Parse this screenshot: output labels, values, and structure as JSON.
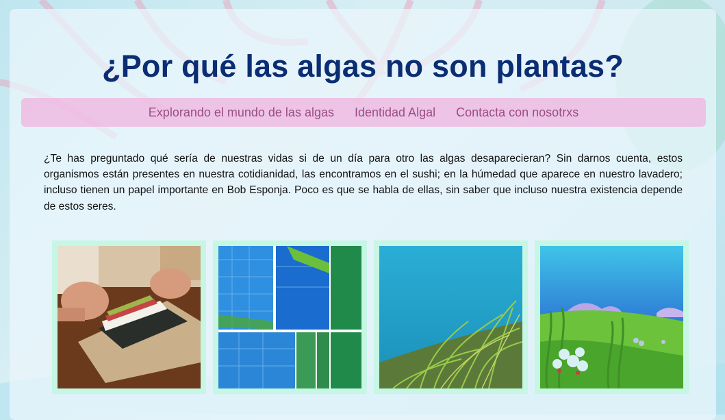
{
  "page": {
    "title": "¿Por qué las algas no son plantas?",
    "nav": [
      {
        "label": "Explorando el mundo de las algas"
      },
      {
        "label": "Identidad Algal"
      },
      {
        "label": "Contacta con nosotrxs"
      }
    ],
    "intro": "¿Te has preguntado qué sería de nuestras vidas si de un día para otro las algas desaparecieran? Sin darnos cuenta, estos organismos están presentes en nuestra cotidianidad, las encontramos en el sushi; en la húmedad que aparece en nuestro lavadero; incluso tienen un papel importante en Bob Esponja. Poco es que se habla de ellas, sin saber que incluso nuestra existencia depende de estos seres."
  },
  "gallery": [
    {
      "name": "sushi-photo"
    },
    {
      "name": "algae-tiles-photo"
    },
    {
      "name": "underwater-seagrass-photo"
    },
    {
      "name": "cartoon-seabed-photo"
    }
  ],
  "colors": {
    "title": "#0b2d73",
    "nav_bg": "#efbae2",
    "nav_text": "#9b4d86",
    "frame": "#c6f6e4"
  }
}
